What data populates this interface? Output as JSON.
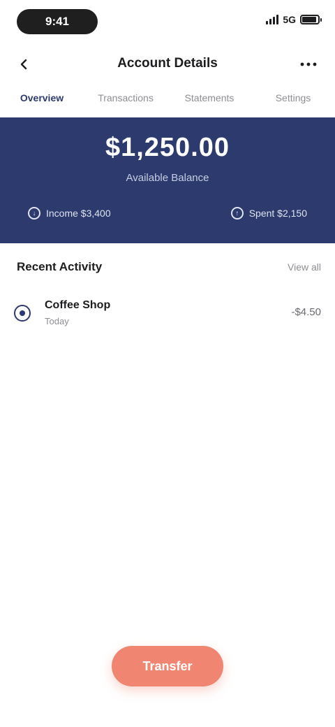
{
  "status_bar": {
    "time": "9:41",
    "network": "5G",
    "battery_level": 0.9
  },
  "header": {
    "title": "Account Details",
    "back_icon": "chevron-left-icon",
    "more_icon": "more-horizontal-icon"
  },
  "tabs": [
    {
      "label": "Overview",
      "active": true
    },
    {
      "label": "Transactions",
      "active": false
    },
    {
      "label": "Statements",
      "active": false
    },
    {
      "label": "Settings",
      "active": false
    }
  ],
  "summary": {
    "amount": "$1,250.00",
    "label": "Available Balance",
    "stats": [
      {
        "icon": "arrow-down-icon",
        "text": "Income $3,400"
      },
      {
        "icon": "arrow-up-icon",
        "text": "Spent $2,150"
      }
    ]
  },
  "recent": {
    "title": "Recent Activity",
    "link": "View all",
    "items": [
      {
        "title": "Coffee Shop",
        "subtitle": "Today",
        "value": "-$4.50"
      }
    ]
  },
  "cta": {
    "label": "Transfer"
  },
  "colors": {
    "brand": "#2c3a6e",
    "accent": "#f08672"
  }
}
